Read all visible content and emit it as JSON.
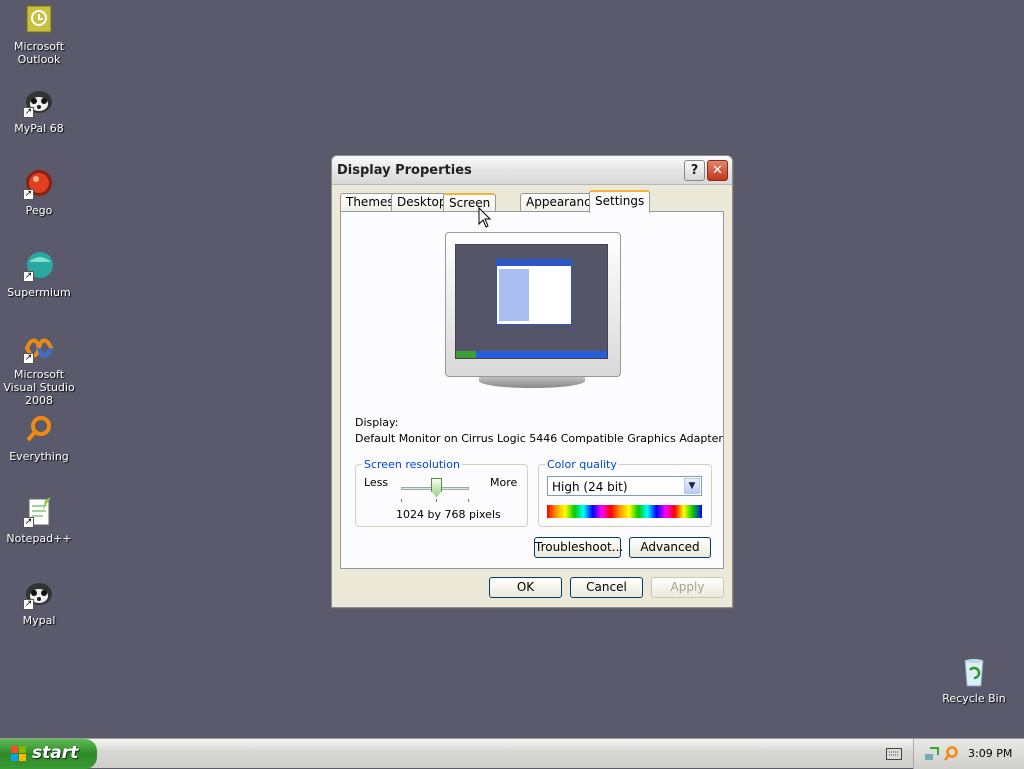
{
  "desktop": {
    "icons": [
      {
        "label": "Microsoft Outlook"
      },
      {
        "label": "MyPal 68"
      },
      {
        "label": "Pego"
      },
      {
        "label": "Supermium"
      },
      {
        "label": "Microsoft Visual Studio 2008"
      },
      {
        "label": "Everything"
      },
      {
        "label": "Notepad++"
      },
      {
        "label": "Mypal"
      }
    ],
    "recycle_bin": "Recycle Bin"
  },
  "dialog": {
    "title": "Display Properties",
    "help_glyph": "?",
    "close_glyph": "✕",
    "tabs": [
      {
        "label": "Themes"
      },
      {
        "label": "Desktop"
      },
      {
        "label": "Screen Saver"
      },
      {
        "label": "Appearance"
      },
      {
        "label": "Settings"
      }
    ],
    "display_label": "Display:",
    "display_value": "Default Monitor on Cirrus Logic 5446 Compatible Graphics Adapter",
    "resolution": {
      "legend": "Screen resolution",
      "less": "Less",
      "more": "More",
      "value": "1024 by 768 pixels"
    },
    "color_quality": {
      "legend": "Color quality",
      "selected": "High (24 bit)",
      "arrow": "▼"
    },
    "buttons": {
      "troubleshoot": "Troubleshoot...",
      "advanced": "Advanced",
      "ok": "OK",
      "cancel": "Cancel",
      "apply": "Apply"
    }
  },
  "taskbar": {
    "start_label": "start",
    "clock": "3:09 PM"
  },
  "colors": {
    "desktop": "#5a5a6c",
    "accent_tab": "#f5b233",
    "legend_blue": "#0046d5",
    "start_green": "#3a9a34"
  }
}
